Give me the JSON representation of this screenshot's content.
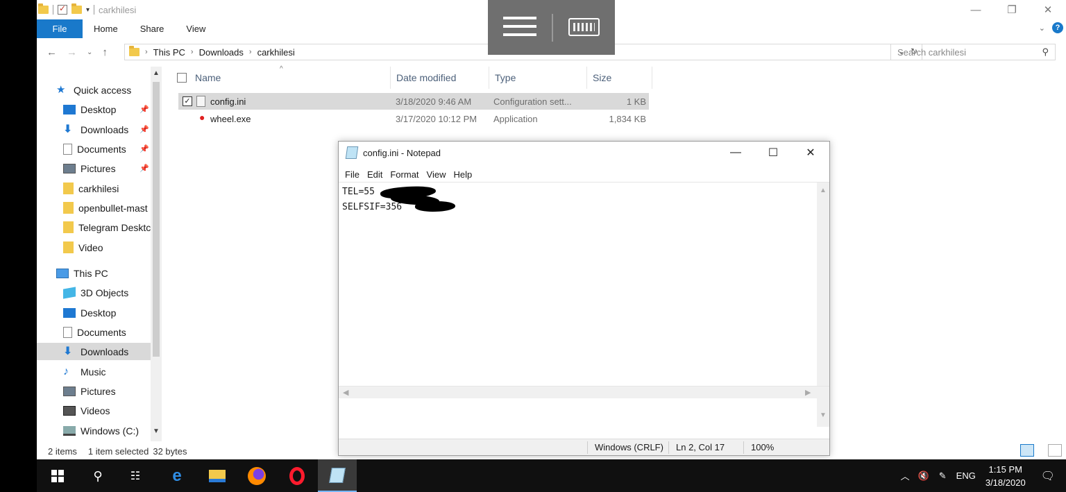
{
  "explorer": {
    "title": "carkhilesi",
    "ribbon_tabs": [
      "File",
      "Home",
      "Share",
      "View"
    ],
    "breadcrumb": [
      "This PC",
      "Downloads",
      "carkhilesi"
    ],
    "search_placeholder": "Search carkhilesi",
    "columns": [
      "Name",
      "Date modified",
      "Type",
      "Size"
    ],
    "files": [
      {
        "name": "config.ini",
        "date": "3/18/2020 9:46 AM",
        "type": "Configuration sett...",
        "size": "1 KB",
        "selected": true
      },
      {
        "name": "wheel.exe",
        "date": "3/17/2020 10:12 PM",
        "type": "Application",
        "size": "1,834 KB",
        "selected": false
      }
    ],
    "sidebar": {
      "quick_access": "Quick access",
      "quick_items": [
        "Desktop",
        "Downloads",
        "Documents",
        "Pictures",
        "carkhilesi",
        "openbullet-mast",
        "Telegram Desktc",
        "Video"
      ],
      "this_pc": "This PC",
      "pc_items": [
        "3D Objects",
        "Desktop",
        "Documents",
        "Downloads",
        "Music",
        "Pictures",
        "Videos",
        "Windows (C:)"
      ]
    },
    "status": {
      "items": "2 items",
      "selected": "1 item selected",
      "size": "32 bytes"
    }
  },
  "notepad": {
    "title": "config.ini - Notepad",
    "menu": [
      "File",
      "Edit",
      "Format",
      "View",
      "Help"
    ],
    "lines": [
      "TEL=55",
      "SELFSIF=356"
    ],
    "status": {
      "encoding": "Windows (CRLF)",
      "position": "Ln 2, Col 17",
      "zoom": "100%"
    }
  },
  "taskbar": {
    "language": "ENG",
    "time": "1:15 PM",
    "date": "3/18/2020"
  },
  "colors": {
    "accent": "#1979ca",
    "selection": "#d9d9d9",
    "taskbar": "#101010",
    "overlay": "#6f6f6f"
  },
  "icons": {
    "overlay": [
      "hamburger-menu-icon",
      "keyboard-icon"
    ],
    "taskbar": [
      "windows-start-icon",
      "search-icon",
      "task-view-icon",
      "edge-icon",
      "file-explorer-icon",
      "firefox-icon",
      "opera-icon",
      "notepad-icon"
    ],
    "tray": [
      "chevron-up-icon",
      "volume-muted-icon",
      "pen-icon",
      "notification-icon"
    ]
  }
}
